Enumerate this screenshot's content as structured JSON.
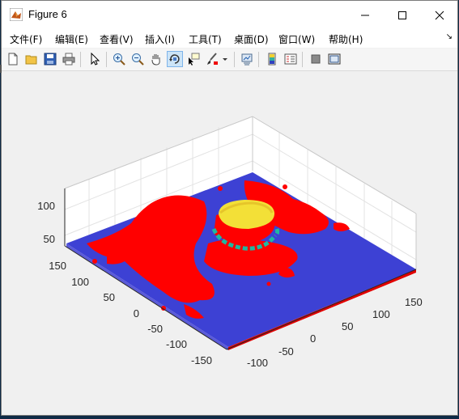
{
  "window": {
    "title": "Figure 6",
    "controls": {
      "minimize": "minimize",
      "maximize": "maximize",
      "close": "close"
    }
  },
  "menu": {
    "items": [
      {
        "label": "文件(F)"
      },
      {
        "label": "编辑(E)"
      },
      {
        "label": "查看(V)"
      },
      {
        "label": "插入(I)"
      },
      {
        "label": "工具(T)"
      },
      {
        "label": "桌面(D)"
      },
      {
        "label": "窗口(W)"
      },
      {
        "label": "帮助(H)"
      }
    ],
    "overflow_arrow": "↘"
  },
  "toolbar": {
    "buttons": [
      {
        "icon": "new-figure-icon"
      },
      {
        "icon": "open-file-icon"
      },
      {
        "icon": "save-icon"
      },
      {
        "icon": "print-icon"
      },
      {
        "icon": "edit-plot-icon"
      },
      {
        "icon": "zoom-in-icon"
      },
      {
        "icon": "zoom-out-icon"
      },
      {
        "icon": "pan-icon"
      },
      {
        "icon": "rotate-3d-icon",
        "active": true
      },
      {
        "icon": "data-cursor-icon"
      },
      {
        "icon": "brush-icon"
      },
      {
        "icon": "link-plot-icon"
      },
      {
        "icon": "insert-colorbar-icon"
      },
      {
        "icon": "insert-legend-icon"
      },
      {
        "icon": "hide-plot-tools-icon"
      },
      {
        "icon": "show-plot-tools-icon"
      }
    ]
  },
  "axes": {
    "z_ticks": [
      "100",
      "50"
    ],
    "y_ticks": [
      "150",
      "100",
      "50",
      "0",
      "-50",
      "-100",
      "-150"
    ],
    "x_ticks": [
      "-100",
      "-50",
      "0",
      "50",
      "100",
      "150"
    ]
  },
  "colors": {
    "surface_base": "#3b3fd6",
    "region_red": "#ff0000",
    "dome_yellow": "#f5e23a",
    "ring_teal": "#1fb5a0",
    "grid": "#e0e0e0"
  }
}
